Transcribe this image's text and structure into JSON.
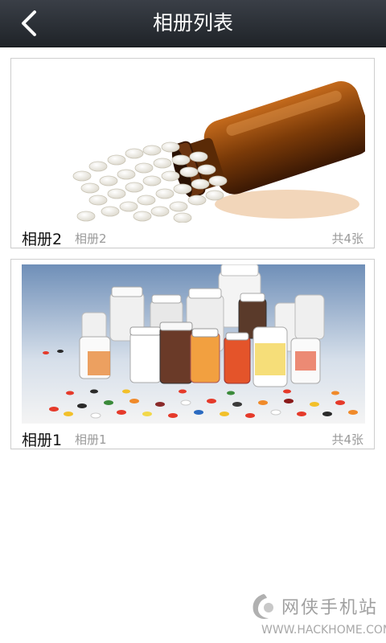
{
  "header": {
    "title": "相册列表",
    "back_icon": "chevron-left-icon",
    "background": "#2b2f35"
  },
  "albums": [
    {
      "name": "相册2",
      "desc": "相册2",
      "count": "共4张",
      "thumbnail": "amber-bottle-pills-photo"
    },
    {
      "name": "相册1",
      "desc": "相册1",
      "count": "共4张",
      "thumbnail": "medicine-bottles-photo"
    }
  ],
  "watermark": {
    "text": "网侠手机站",
    "url": "WWW.HACKHOME.COM"
  }
}
